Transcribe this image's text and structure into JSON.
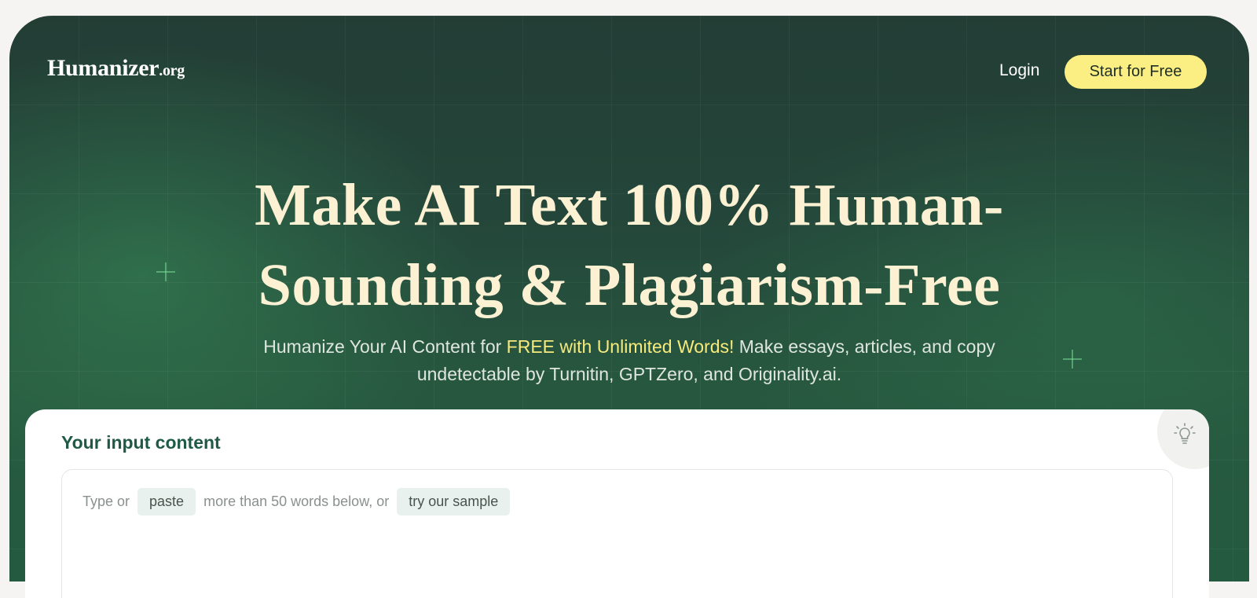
{
  "nav": {
    "logo_main": "Humanizer",
    "logo_tld": ".org",
    "login_label": "Login",
    "cta_label": "Start for Free"
  },
  "hero": {
    "headline_line1": "Make AI Text 100% Human-",
    "headline_line2": "Sounding & Plagiarism-Free",
    "sub_part1": "Humanize Your AI Content for ",
    "sub_highlight": "FREE with Unlimited Words!",
    "sub_part2": " Make essays, articles, and copy",
    "sub_line2": "undetectable by Turnitin, GPTZero, and Originality.ai."
  },
  "input_panel": {
    "title": "Your input content",
    "hint_prefix": "Type or",
    "paste_label": "paste",
    "hint_middle": "more than 50 words below, or",
    "sample_label": "try our sample",
    "tip_icon": "lightbulb-icon"
  },
  "colors": {
    "hero_bg": "#24463a",
    "accent_yellow": "#fbef84",
    "headline": "#fdf1d4",
    "title_green": "#1e5a46"
  }
}
